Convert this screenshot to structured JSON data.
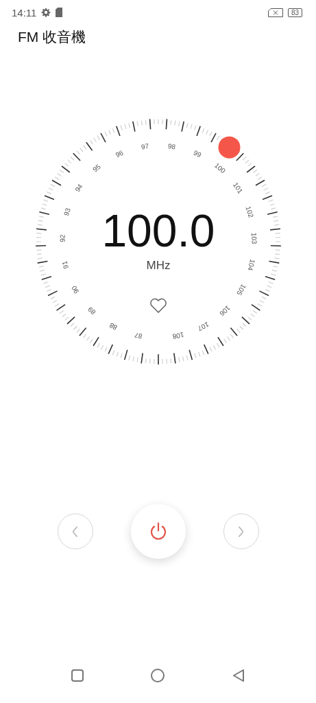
{
  "status_bar": {
    "time": "14:11",
    "battery": "83"
  },
  "app_bar": {
    "title": "FM 收音機"
  },
  "dial": {
    "labels": [
      "87",
      "88",
      "89",
      "90",
      "91",
      "92",
      "93",
      "94",
      "95",
      "96",
      "97",
      "98",
      "99",
      "100",
      "101",
      "102",
      "103",
      "104",
      "105",
      "106",
      "107",
      "108"
    ],
    "frequency": "100.0",
    "unit": "MHz",
    "favorite": false
  }
}
